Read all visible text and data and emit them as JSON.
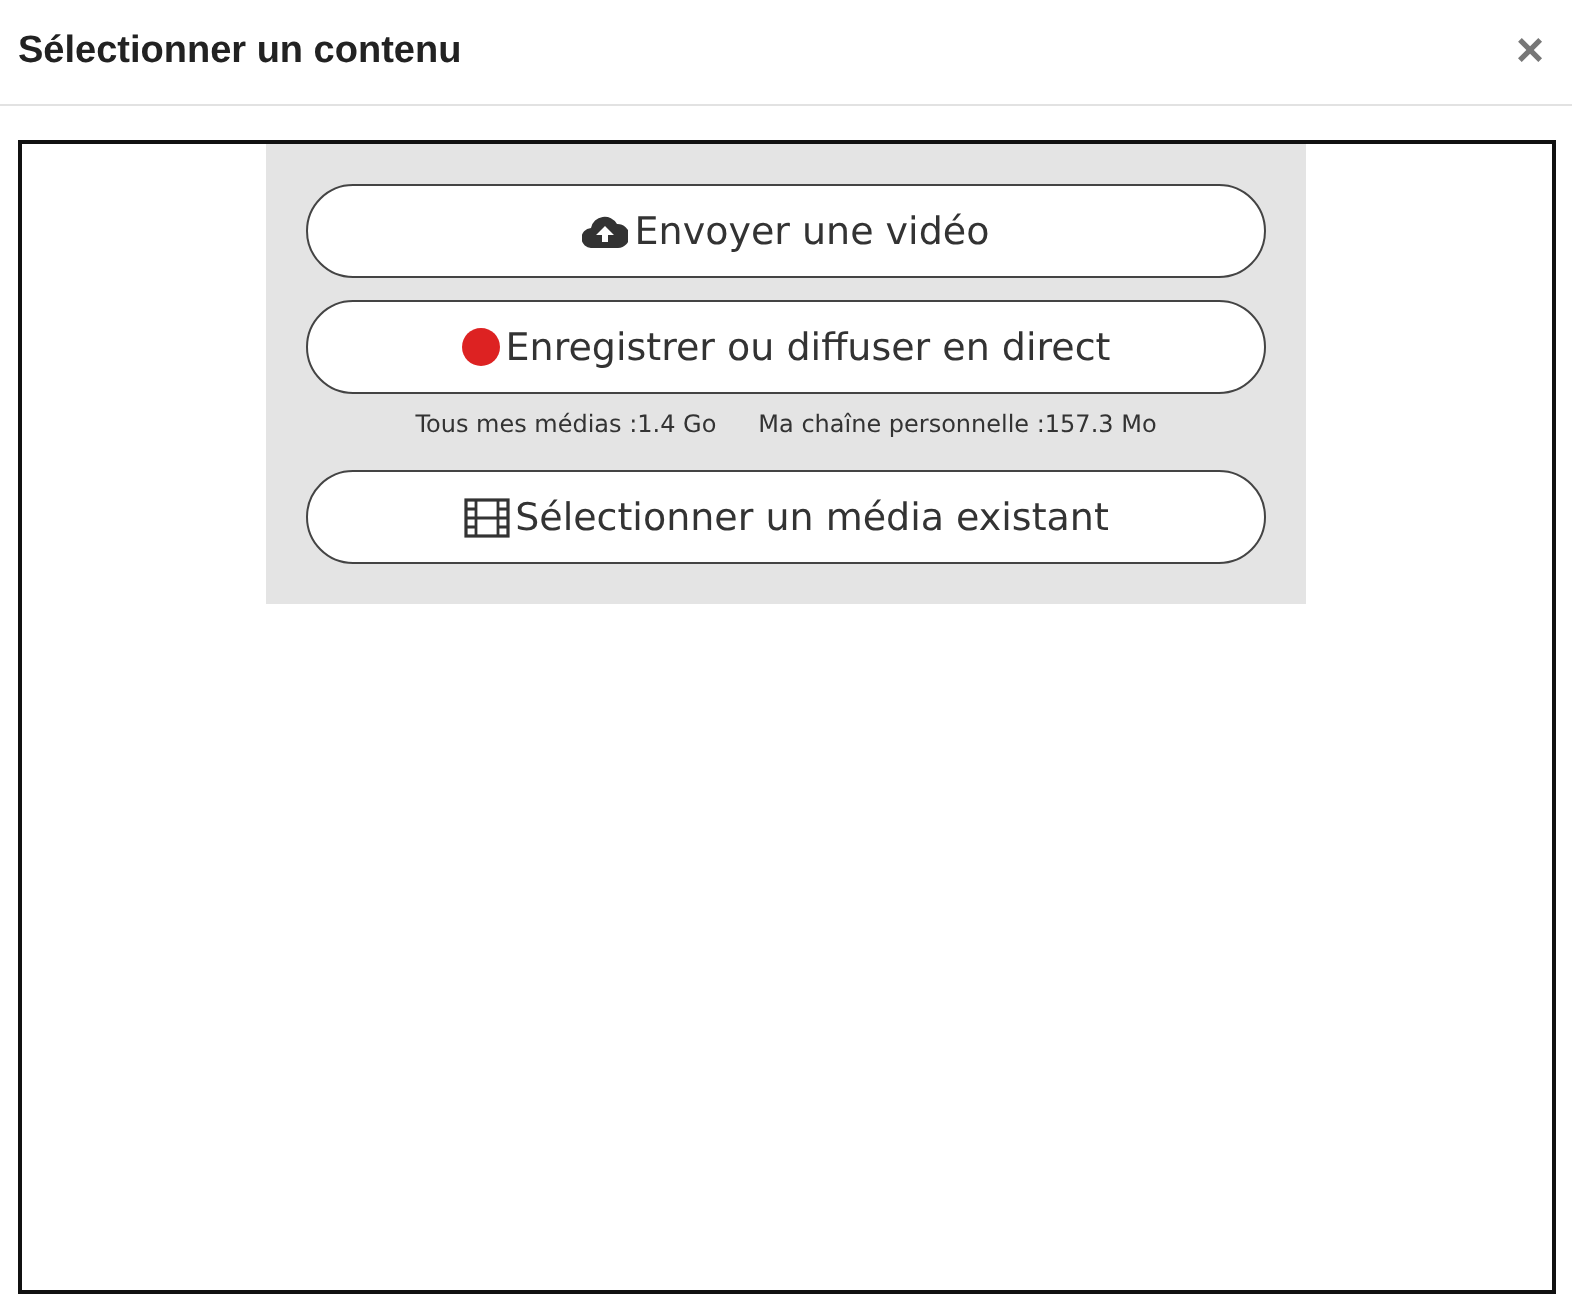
{
  "dialog": {
    "title": "Sélectionner un contenu",
    "close": "×"
  },
  "actions": [
    {
      "kind": "upload",
      "label": "Envoyer une vidéo"
    },
    {
      "kind": "record",
      "label": "Enregistrer ou diffuser en direct"
    }
  ],
  "quotas": [
    "Tous mes médias :1.4 Go",
    "Ma chaîne personnelle :157.3 Mo"
  ],
  "after_actions": [
    {
      "kind": "film",
      "label": "Sélectionner un média existant"
    }
  ]
}
